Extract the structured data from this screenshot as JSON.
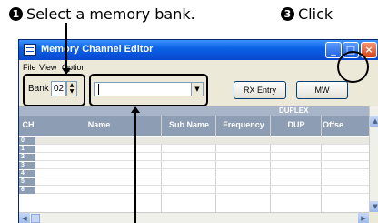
{
  "callouts": {
    "step1": {
      "number": "1",
      "text": "Select a memory bank."
    },
    "step3": {
      "number": "3",
      "text": "Click"
    }
  },
  "window": {
    "title": "Memory Channel Editor",
    "buttons": {
      "minimize": "_",
      "maximize": "□",
      "close": "×"
    }
  },
  "menu": {
    "file": "File",
    "view": "View",
    "option": "Option"
  },
  "toolbar": {
    "bank_label": "Bank",
    "bank_value": "02",
    "combo_value": "",
    "rx_entry_label": "RX Entry",
    "mw_label": "MW"
  },
  "table": {
    "group_header": "DUPLEX",
    "columns": [
      "CH",
      "Name",
      "Sub Name",
      "Frequency",
      "DUP",
      "Offse"
    ],
    "rows": [
      "0",
      "1",
      "2",
      "3",
      "4",
      "5",
      "6"
    ]
  },
  "colors": {
    "title_bar": "#0B61E5",
    "close_button": "#D8431B",
    "grid_header": "#8C9DB4"
  },
  "icons": [
    "app-icon",
    "minimize-icon",
    "maximize-icon",
    "close-icon",
    "spin-up-icon",
    "spin-down-icon",
    "dropdown-arrow-icon",
    "scroll-up-icon",
    "scroll-down-icon",
    "scroll-left-icon",
    "scroll-right-icon"
  ]
}
